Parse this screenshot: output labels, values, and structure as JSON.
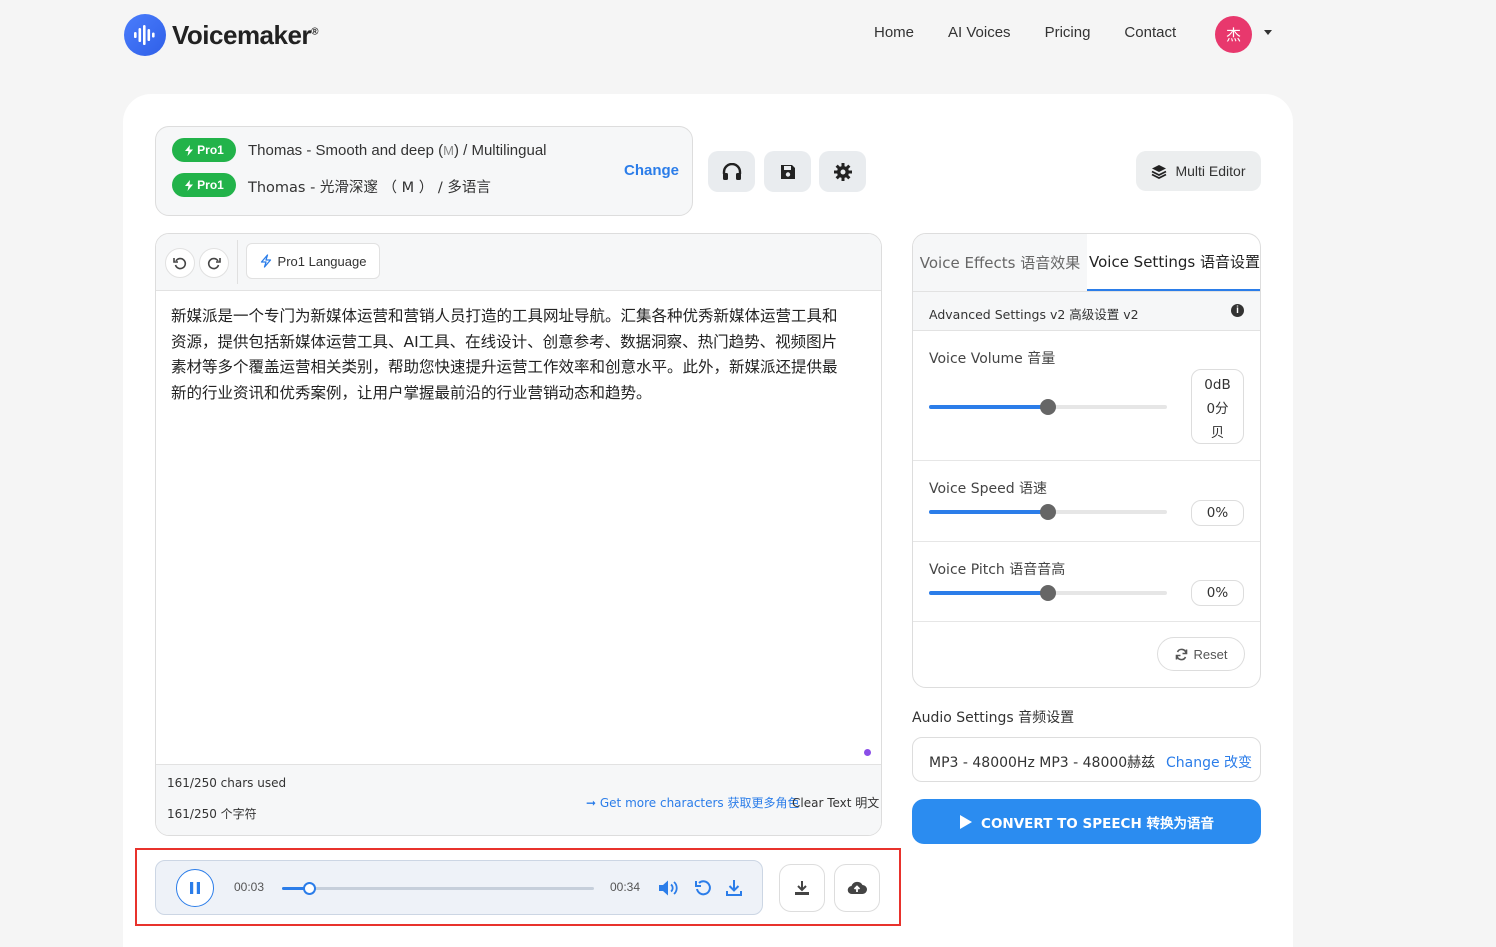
{
  "header": {
    "brand": "Voicemaker",
    "brand_mark": "®",
    "nav": [
      "Home",
      "AI Voices",
      "Pricing",
      "Contact"
    ],
    "avatar_initial": "杰"
  },
  "voice": {
    "badge": "Pro1",
    "line1_prefix": "Thomas - Smooth and deep (",
    "line1_m": "M",
    "line1_suffix": ") / Multilingual",
    "line2": "Thomas - 光滑深邃 （ M ） / 多语言",
    "change_label": "Change"
  },
  "toolbar": {
    "multi_editor": "Multi Editor",
    "language_btn": "Pro1 Language"
  },
  "editor": {
    "text_lines": [
      "新媒派是一个专门为新媒体运营和营销人员打造的工具网址导航。汇集各种优秀新媒体运营工具和",
      "资源，提供包括新媒体运营工具、AI工具、在线设计、创意参考、数据洞察、热门趋势、视频图片",
      "素材等多个覆盖运营相关类别，帮助您快速提升运营工作效率和创意水平。此外，新媒派还提供最",
      "新的行业资讯和优秀案例，让用户掌握最前沿的行业营销动态和趋势。"
    ],
    "chars_used": "161/250 chars used",
    "chars_used_cn": "161/250 个字符",
    "more_chars": "➞ Get more characters 获取更多角色",
    "clear_text": "Clear Text 明文"
  },
  "settings": {
    "tab_effects": "Voice Effects 语音效果",
    "tab_settings": "Voice Settings 语音设置",
    "advanced": "Advanced Settings v2 高级设置 v2",
    "info_glyph": "i",
    "volume_label": "Voice Volume 音量",
    "volume_value_lines": [
      "0dB",
      "0分",
      "贝"
    ],
    "volume_level": 0.5,
    "speed_label": "Voice Speed 语速",
    "speed_value": "0%",
    "speed_level": 0.5,
    "pitch_label": "Voice Pitch 语音音高",
    "pitch_value": "0%",
    "pitch_level": 0.5,
    "reset": "Reset"
  },
  "audio": {
    "label": "Audio Settings 音频设置",
    "format": "MP3 - 48000Hz MP3 - 48000赫兹",
    "change": "Change 改变"
  },
  "convert": {
    "label": "CONVERT TO SPEECH 转换为语音"
  },
  "player": {
    "current_time": "00:03",
    "total_time": "00:34",
    "progress_fraction": 0.088
  },
  "colors": {
    "accent": "#2b7de9",
    "pro_badge": "#22b34a",
    "avatar": "#e8386d",
    "highlight": "#e8322c"
  }
}
